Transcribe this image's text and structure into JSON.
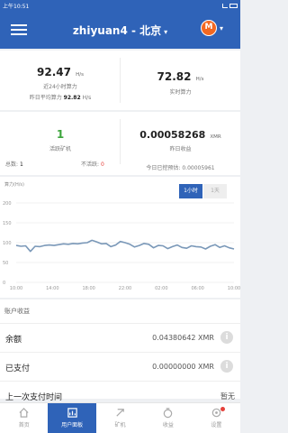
{
  "status_bar": {
    "time": "上午10:51"
  },
  "header": {
    "title": "zhiyuan4 - 北京",
    "caret": "▾",
    "coin_symbol": "M"
  },
  "hashrate": {
    "left_value": "92.47",
    "left_unit": "H/s",
    "left_label": "近24小时算力",
    "yesterday_label": "昨日平均算力",
    "yesterday_value": "92.82",
    "yesterday_unit": "H/s",
    "right_value": "72.82",
    "right_unit": "H/s",
    "right_label": "实时算力"
  },
  "workers": {
    "active_count": "1",
    "active_label": "活跃矿机",
    "total_label": "总数:",
    "total_value": "1",
    "inactive_label": "不活跃:",
    "inactive_value": "0"
  },
  "earnings_summary": {
    "value": "0.00058268",
    "unit": "XMR",
    "label": "昨日收益",
    "forecast_label": "今日已挖预估:",
    "forecast_value": "0.00005961"
  },
  "chart": {
    "label": "算力(H/s)",
    "toggle_1h": "1小时",
    "toggle_1d": "1天"
  },
  "chart_data": {
    "type": "line",
    "ylabel": "算力(H/s)",
    "ylim": [
      0,
      200
    ],
    "yticks": [
      "200",
      "150",
      "100",
      "50",
      "0"
    ],
    "xticks": [
      "10:00",
      "14:00",
      "18:00",
      "22:00",
      "02:00",
      "06:00",
      "10:00"
    ],
    "values": [
      93,
      91,
      92,
      78,
      91,
      90,
      93,
      94,
      93,
      95,
      97,
      96,
      98,
      97,
      99,
      100,
      106,
      102,
      97,
      98,
      90,
      94,
      103,
      100,
      96,
      89,
      93,
      98,
      96,
      87,
      93,
      92,
      85,
      90,
      94,
      88,
      86,
      92,
      90,
      89,
      84,
      91,
      95,
      88,
      92,
      87,
      84
    ],
    "colors": {
      "line": "#7a98b8",
      "grid": "#e6e6e6"
    }
  },
  "account": {
    "title": "账户收益",
    "rows": [
      {
        "label": "余额",
        "value": "0.04380642 XMR"
      },
      {
        "label": "已支付",
        "value": "0.00000000 XMR"
      },
      {
        "label": "上一次支付时间",
        "value": "暂无"
      }
    ]
  },
  "tabs": [
    {
      "label": "首页",
      "icon": "home-icon"
    },
    {
      "label": "用户面板",
      "icon": "dashboard-icon"
    },
    {
      "label": "矿机",
      "icon": "worker-icon"
    },
    {
      "label": "收益",
      "icon": "wallet-icon"
    },
    {
      "label": "设置",
      "icon": "settings-icon"
    }
  ]
}
